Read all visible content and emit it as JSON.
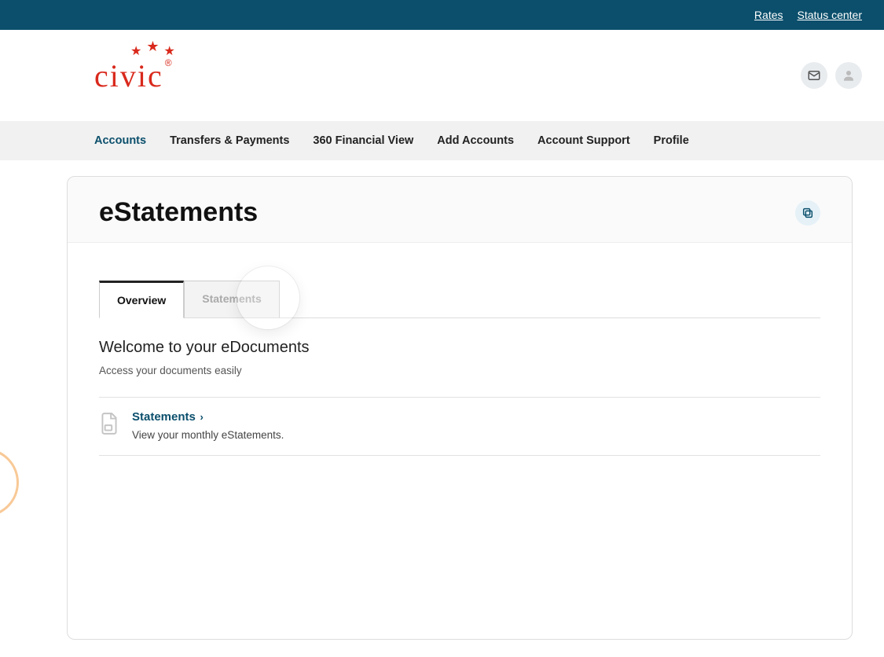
{
  "topbar": {
    "links": [
      "Rates",
      "Status center"
    ]
  },
  "brand": {
    "name": "civic"
  },
  "nav": {
    "items": [
      "Accounts",
      "Transfers & Payments",
      "360 Financial View",
      "Add Accounts",
      "Account Support",
      "Profile"
    ],
    "active_index": 0
  },
  "page": {
    "title": "eStatements",
    "tabs": [
      "Overview",
      "Statements"
    ],
    "active_tab_index": 0,
    "welcome_heading": "Welcome to your eDocuments",
    "welcome_sub": "Access your documents easily",
    "doc": {
      "link_label": "Statements",
      "description": "View your monthly eStatements."
    }
  }
}
